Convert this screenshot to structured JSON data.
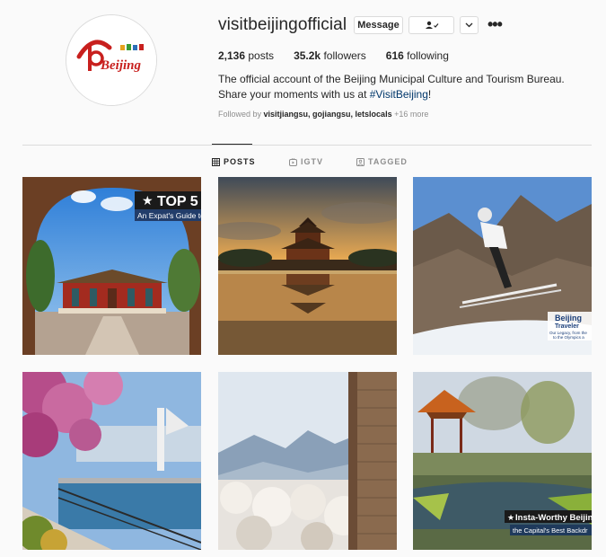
{
  "profile": {
    "username": "visitbeijingofficial",
    "avatar_logo_text": "Beijing",
    "buttons": {
      "message": "Message"
    },
    "stats": {
      "posts_count": "2,136",
      "posts_label": "posts",
      "followers_count": "35.2k",
      "followers_label": "followers",
      "following_count": "616",
      "following_label": "following"
    },
    "bio": {
      "line1": "The official account of the Beijing Municipal Culture and Tourism Bureau.",
      "line2_prefix": "Share your moments with us at ",
      "hashtag": "#VisitBeijing",
      "line2_suffix": "!"
    },
    "followed_by": {
      "prefix": "Followed by ",
      "accounts": "visitjiangsu, gojiangsu, letslocals",
      "more": "+16 more"
    }
  },
  "tabs": [
    {
      "label": "POSTS",
      "icon": "grid-icon",
      "active": true
    },
    {
      "label": "IGTV",
      "icon": "igtv-icon",
      "active": false
    },
    {
      "label": "TAGGED",
      "icon": "tagged-icon",
      "active": false
    }
  ],
  "posts": [
    {
      "overlay_title": "TOP 5",
      "overlay_subtitle": "An Expat's Guide to"
    },
    {
      "overlay_title": ""
    },
    {
      "overlay_title": "Beijing",
      "overlay_subtitle": "Traveler",
      "overlay_caption_1": "Our Legacy, from the",
      "overlay_caption_2": "to the Olympics a"
    },
    {
      "overlay_title": ""
    },
    {
      "overlay_title": ""
    },
    {
      "overlay_title": "Insta-Worthy Beijin",
      "overlay_subtitle": "the Capital's Best Backdr"
    }
  ],
  "colors": {
    "link_blue": "#00376b",
    "border": "#dbdbdb",
    "muted_text": "#8e8e8e",
    "logo_red": "#c8201e",
    "logo_green": "#3a9b35"
  }
}
